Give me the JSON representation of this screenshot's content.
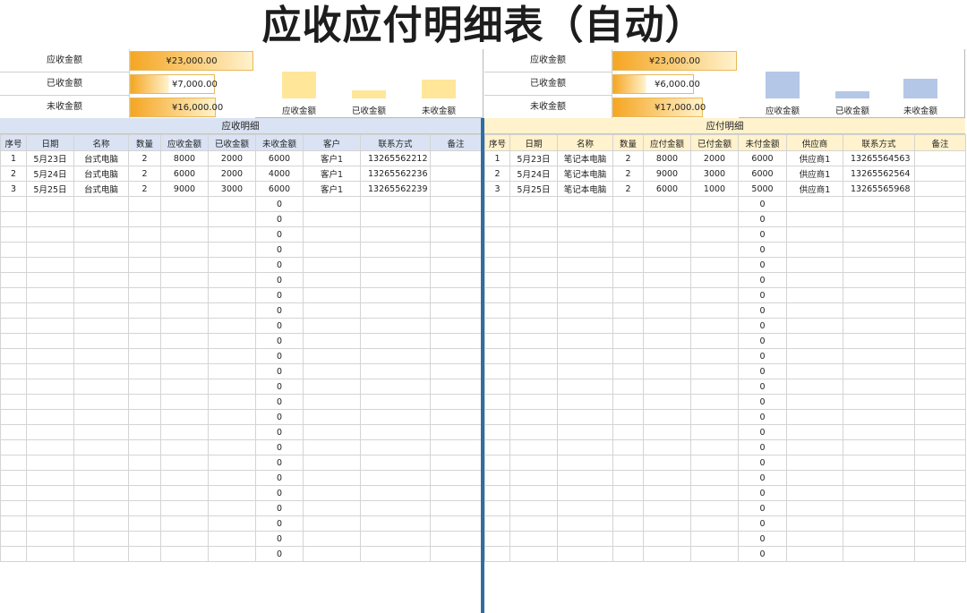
{
  "title": "应收应付明细表（自动）",
  "left_summary": {
    "rows": [
      {
        "label": "应收金额",
        "value": "¥23,000.00"
      },
      {
        "label": "已收金额",
        "value": "¥7,000.00"
      },
      {
        "label": "未收金额",
        "value": "¥16,000.00"
      }
    ],
    "bar_labels": [
      "应收金额",
      "已收金额",
      "未收金额"
    ],
    "bar_values": [
      23000,
      7000,
      16000
    ],
    "bar_color": "#ffe699"
  },
  "right_summary": {
    "rows": [
      {
        "label": "应收金额",
        "value": "¥23,000.00"
      },
      {
        "label": "已收金额",
        "value": "¥6,000.00"
      },
      {
        "label": "未收金额",
        "value": "¥17,000.00"
      }
    ],
    "bar_labels": [
      "应收金额",
      "已收金额",
      "未收金额"
    ],
    "bar_values": [
      23000,
      6000,
      17000
    ],
    "bar_color": "#b4c7e7"
  },
  "receivable": {
    "title": "应收明细",
    "columns": [
      "序号",
      "日期",
      "名称",
      "数量",
      "应收金额",
      "已收金额",
      "未收金额",
      "客户",
      "联系方式",
      "备注"
    ],
    "rows": [
      [
        "1",
        "5月23日",
        "台式电脑",
        "2",
        "8000",
        "2000",
        "6000",
        "客户1",
        "13265562212",
        ""
      ],
      [
        "2",
        "5月24日",
        "台式电脑",
        "2",
        "6000",
        "2000",
        "4000",
        "客户1",
        "13265562236",
        ""
      ],
      [
        "3",
        "5月25日",
        "台式电脑",
        "2",
        "9000",
        "3000",
        "6000",
        "客户1",
        "13265562239",
        ""
      ]
    ],
    "empty_value": "0"
  },
  "payable": {
    "title": "应付明细",
    "columns": [
      "序号",
      "日期",
      "名称",
      "数量",
      "应付金额",
      "已付金额",
      "未付金额",
      "供应商",
      "联系方式",
      "备注"
    ],
    "rows": [
      [
        "1",
        "5月23日",
        "笔记本电脑",
        "2",
        "8000",
        "2000",
        "6000",
        "供应商1",
        "13265564563",
        ""
      ],
      [
        "2",
        "5月24日",
        "笔记本电脑",
        "2",
        "9000",
        "3000",
        "6000",
        "供应商1",
        "13265562564",
        ""
      ],
      [
        "3",
        "5月25日",
        "笔记本电脑",
        "2",
        "6000",
        "1000",
        "5000",
        "供应商1",
        "13265565968",
        ""
      ]
    ],
    "empty_value": "0"
  },
  "colors": {
    "receivable_header": "#dae3f3",
    "payable_header": "#fff2cc",
    "divider": "#2f6ea3",
    "value_box_start": "#f5a623",
    "value_box_end": "#fff2cc"
  }
}
